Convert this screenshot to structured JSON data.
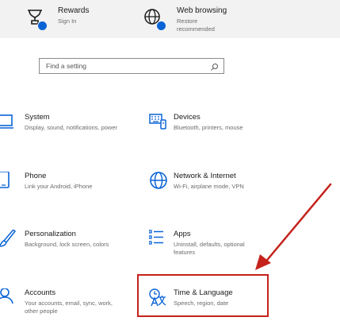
{
  "top_items": [
    {
      "title": "Rewards",
      "subtitle": "Sign In",
      "icon": "rewards-trophy-icon"
    },
    {
      "title": "Web browsing",
      "subtitle": "Restore recommended",
      "icon": "globe-icon"
    }
  ],
  "search": {
    "placeholder": "Find a setting",
    "icon": "search-icon"
  },
  "tiles": [
    {
      "title": "System",
      "subtitle": "Display, sound, notifications, power",
      "icon": "laptop-icon"
    },
    {
      "title": "Devices",
      "subtitle": "Bluetooth, printers, mouse",
      "icon": "keyboard-icon"
    },
    {
      "title": "Phone",
      "subtitle": "Link your Android, iPhone",
      "icon": "phone-icon"
    },
    {
      "title": "Network & Internet",
      "subtitle": "Wi-Fi, airplane mode, VPN",
      "icon": "globe-icon"
    },
    {
      "title": "Personalization",
      "subtitle": "Background, lock screen, colors",
      "icon": "paintbrush-icon"
    },
    {
      "title": "Apps",
      "subtitle": "Uninstall, defaults, optional features",
      "icon": "apps-list-icon"
    },
    {
      "title": "Accounts",
      "subtitle": "Your accounts, email, sync, work, other people",
      "icon": "person-icon"
    },
    {
      "title": "Time & Language",
      "subtitle": "Speech, region, date",
      "icon": "time-language-icon"
    }
  ],
  "colors": {
    "accent": "#0a64d6",
    "annotation": "#c4221b",
    "topbar_bg": "#f2f2f2"
  }
}
